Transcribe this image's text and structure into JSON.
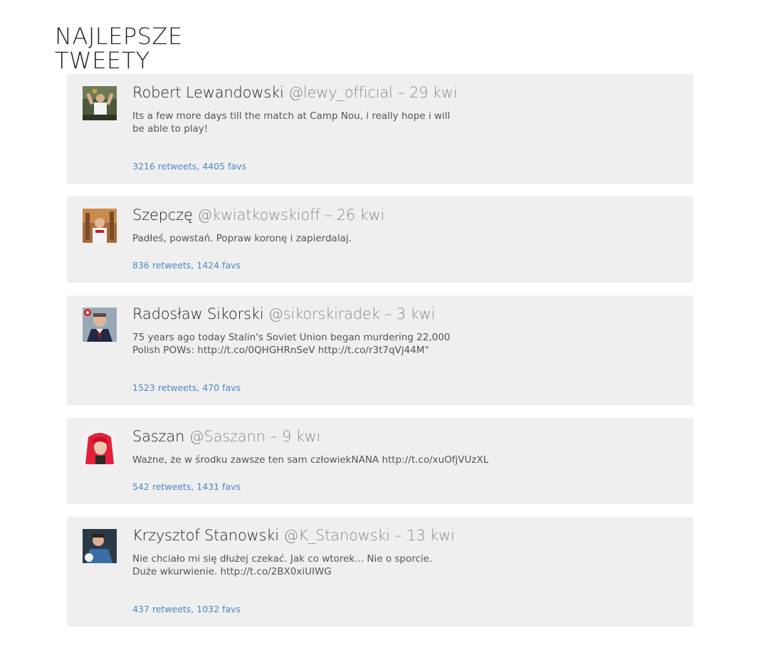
{
  "page": {
    "title_line1": "NAJLEPSZE",
    "title_line2": "TWEETY"
  },
  "tweets": [
    {
      "author": "Robert Lewandowski",
      "handle": "@lewy_official",
      "separator": "–",
      "date": "29 kwi",
      "text": "Its a few more days till the match at Camp Nou, i really hope i will be able to play!",
      "stats": "3216 retweets, 4405 favs",
      "retweets": 3216,
      "favs": 4405
    },
    {
      "author": "Szepczę",
      "handle": "@kwiatkowskioff",
      "separator": "–",
      "date": "26 kwi",
      "text": "Padłeś, powstań. Popraw koronę i zapierdalaj.",
      "stats": "836 retweets, 1424 favs",
      "retweets": 836,
      "favs": 1424
    },
    {
      "author": "Radosław Sikorski",
      "handle": "@sikorskiradek",
      "separator": "–",
      "date": "3 kwi",
      "text": "75 years ago today Stalin's Soviet Union began murdering 22,000 Polish POWs: http://t.co/0QHGHRnSeV http://t.co/r3t7qVj44M\"",
      "stats": "1523 retweets, 470 favs",
      "retweets": 1523,
      "favs": 470
    },
    {
      "author": "Saszan",
      "handle": "@Saszann",
      "separator": "–",
      "date": "9 kwi",
      "text": "Ważne, że w środku zawsze ten sam człowiekNANA http://t.co/xuOfjVUzXL",
      "stats": "542 retweets, 1431 favs",
      "retweets": 542,
      "favs": 1431
    },
    {
      "author": "Krzysztof Stanowski",
      "handle": "@K_Stanowski",
      "separator": "–",
      "date": "13 kwi",
      "text": "Nie chciało mi się dłużej czekać. Jak co wtorek... Nie o sporcie. Duże wkurwienie.  http://t.co/2BX0xiUIWG",
      "stats": "437 retweets, 1032 favs",
      "retweets": 437,
      "favs": 1032
    }
  ]
}
